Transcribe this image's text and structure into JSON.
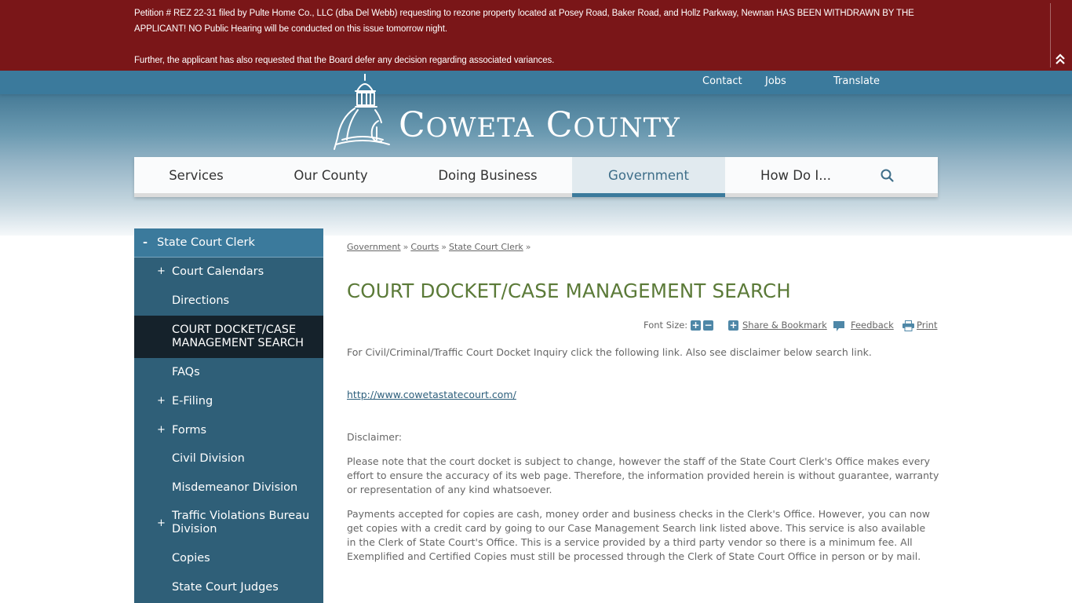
{
  "alert": {
    "line1": "Petition # REZ 22-31 filed by Pulte Home Co., LLC (dba Del Webb) requesting to rezone property located at Posey Road, Baker Road, and Hollz Parkway, Newnan HAS BEEN WITHDRAWN BY THE APPLICANT! NO Public Hearing will be conducted on this issue tomorrow night.",
    "line2": "Further, the applicant has also requested that the Board defer any decision regarding associated variances.",
    "collapse_icon": "double-chevron-up-icon",
    "background": "#7a1618"
  },
  "utility": {
    "links": [
      "Contact",
      "Jobs",
      "Translate"
    ]
  },
  "logo": {
    "first_initial": "C",
    "first_rest": "OWETA",
    "second_initial": "C",
    "second_rest": "OUNTY",
    "alt": "Coweta County"
  },
  "nav": {
    "items": [
      "Services",
      "Our County",
      "Doing Business",
      "Government",
      "How Do I..."
    ],
    "active": "Government",
    "search_icon": "search-icon",
    "accent": "#3b7a9c"
  },
  "sidebar": {
    "heading": "State Court Clerk",
    "heading_toggle": "-",
    "items": [
      {
        "label": "Court Calendars",
        "expandable": true
      },
      {
        "label": "Directions",
        "expandable": false
      },
      {
        "label": "COURT DOCKET/CASE MANAGEMENT SEARCH",
        "expandable": false,
        "current": true
      },
      {
        "label": "FAQs",
        "expandable": false
      },
      {
        "label": "E-Filing",
        "expandable": true
      },
      {
        "label": "Forms",
        "expandable": true
      },
      {
        "label": "Civil Division",
        "expandable": false
      },
      {
        "label": "Misdemeanor Division",
        "expandable": false
      },
      {
        "label": "Traffic Violations Bureau Division",
        "expandable": true
      },
      {
        "label": "Copies",
        "expandable": false
      },
      {
        "label": "State Court Judges",
        "expandable": false
      }
    ],
    "expand_symbol": "+"
  },
  "breadcrumb": {
    "items": [
      "Government",
      "Courts",
      "State Court Clerk"
    ],
    "separator": "»"
  },
  "page": {
    "title": "COURT DOCKET/CASE MANAGEMENT SEARCH",
    "title_color": "#5b7a38"
  },
  "tools": {
    "font_size_label": "Font Size:",
    "increase": "+",
    "decrease": "−",
    "share": "Share & Bookmark",
    "feedback": "Feedback",
    "print": "Print"
  },
  "content": {
    "intro": "For Civil/Criminal/Traffic Court Docket Inquiry click the following link. Also see disclaimer below search link.",
    "link": "http://www.cowetastatecourt.com/",
    "disclaimer_label": "Disclaimer:",
    "disclaimer": "Please note that the court docket is subject to change, however the staff of the State Court Clerk's Office makes every effort to ensure the accuracy of its web page. Therefore, the information provided herein is without guarantee, warranty or representation of any kind whatsoever.",
    "payments": "Payments accepted for copies are cash, money order and business checks in the Clerk's Office.  However, you can now get copies with a credit card by going to our Case Management Search link listed above.  This service is also available in the Clerk of State Court's Office.  This is a service provided by a third party vendor so there is a minimum fee.  All Exemplified and Certified Copies must still be processed through the Clerk of State Court Office in person or by mail."
  }
}
